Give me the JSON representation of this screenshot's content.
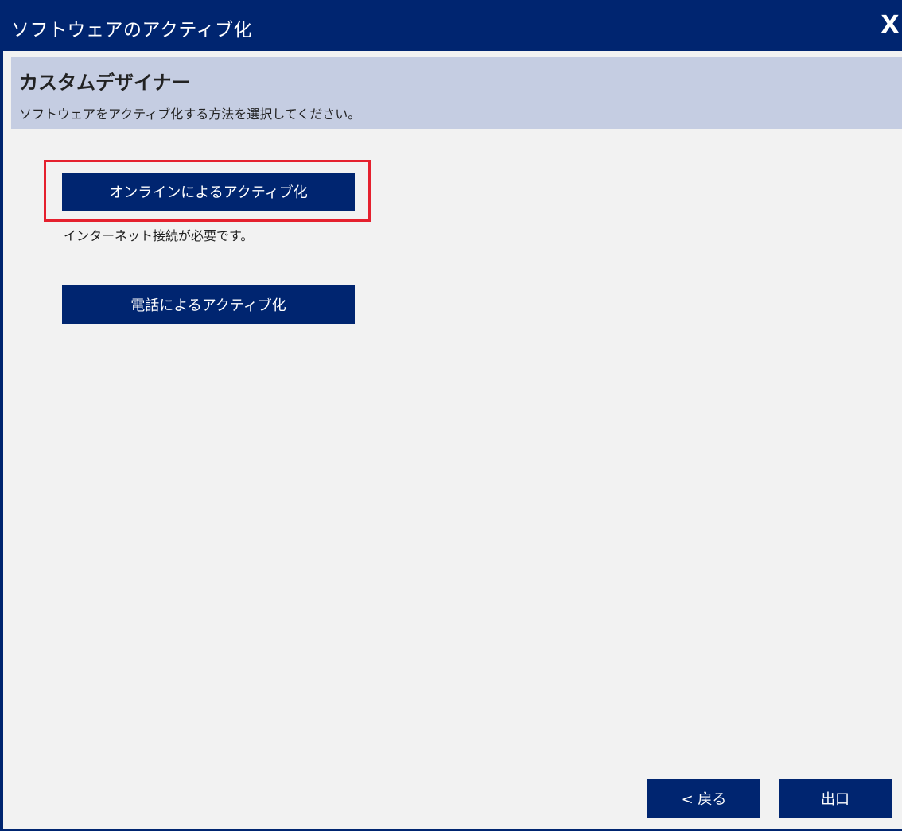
{
  "window": {
    "title": "ソフトウェアのアクティブ化",
    "close_label": "X"
  },
  "header": {
    "title": "カスタムデザイナー",
    "description": "ソフトウェアをアクティブ化する方法を選択してください。"
  },
  "options": {
    "online_label": "オンラインによるアクティブ化",
    "online_note": "インターネット接続が必要です。",
    "phone_label": "電話によるアクティブ化"
  },
  "footer": {
    "back_label": "< 戻る",
    "exit_label": "出口"
  },
  "colors": {
    "primary": "#002570",
    "header_band": "#c5cde2",
    "background": "#f2f2f2",
    "highlight": "#e5202e"
  }
}
